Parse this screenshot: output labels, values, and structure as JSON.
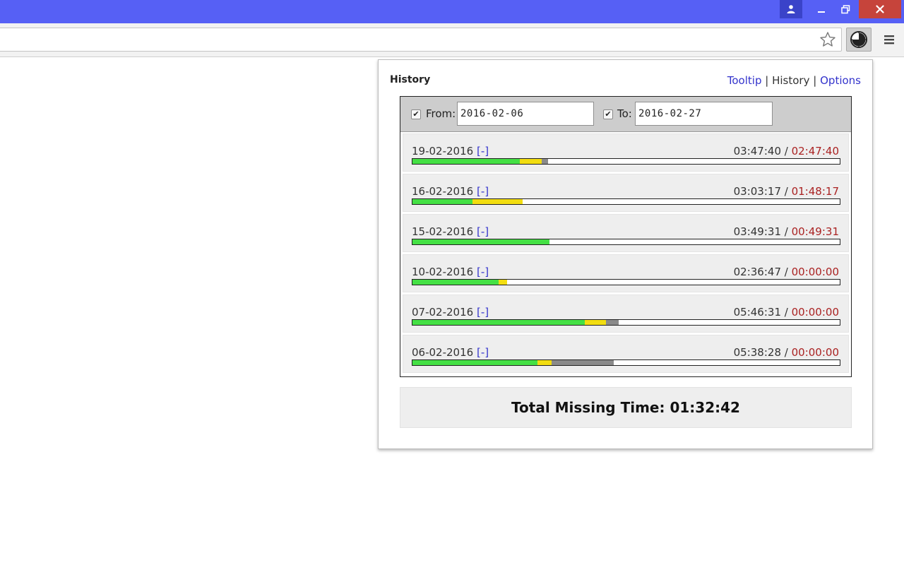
{
  "window": {
    "user_icon": "person-icon",
    "minimize_icon": "minimize-icon",
    "maximize_icon": "restore-icon",
    "close_icon": "close-icon"
  },
  "toolbar": {
    "star_icon": "star-outline-icon",
    "extension_icon": "clock-icon",
    "menu_icon": "hamburger-menu-icon"
  },
  "popup": {
    "title": "History",
    "nav": {
      "tooltip": "Tooltip",
      "history": "History",
      "options": "Options",
      "separator": "|"
    },
    "filter": {
      "from_label": "From:",
      "from_checked": true,
      "from_value": "2016-02-06",
      "to_label": "To:",
      "to_checked": true,
      "to_value": "2016-02-27"
    },
    "remove_label": "[-]",
    "time_separator": "/",
    "colors": {
      "worked": "#44e044",
      "break": "#f2dd10",
      "idle": "#8a8a8a",
      "missing_text": "#aa2222",
      "link": "#3333cc"
    },
    "days": [
      {
        "date": "19-02-2016",
        "worked": "03:47:40",
        "missing": "02:47:40",
        "green": 0.252,
        "yellow": 0.052,
        "gray": 0.015
      },
      {
        "date": "16-02-2016",
        "worked": "03:03:17",
        "missing": "01:48:17",
        "green": 0.14,
        "yellow": 0.118,
        "gray": 0
      },
      {
        "date": "15-02-2016",
        "worked": "03:49:31",
        "missing": "00:49:31",
        "green": 0.321,
        "yellow": 0,
        "gray": 0
      },
      {
        "date": "10-02-2016",
        "worked": "02:36:47",
        "missing": "00:00:00",
        "green": 0.201,
        "yellow": 0.02,
        "gray": 0
      },
      {
        "date": "07-02-2016",
        "worked": "05:46:31",
        "missing": "00:00:00",
        "green": 0.404,
        "yellow": 0.05,
        "gray": 0.03
      },
      {
        "date": "06-02-2016",
        "worked": "05:38:28",
        "missing": "00:00:00",
        "green": 0.293,
        "yellow": 0.033,
        "gray": 0.145
      }
    ],
    "total": "Total Missing Time: 01:32:42"
  }
}
